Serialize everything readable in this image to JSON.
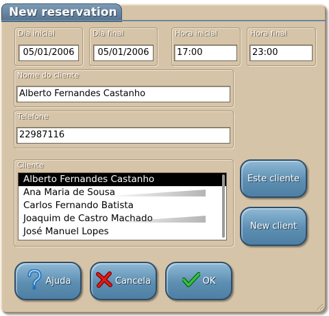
{
  "window": {
    "title": "New reservation"
  },
  "fields": {
    "start_day": {
      "label": "Dia inicial",
      "value": "05/01/2006"
    },
    "end_day": {
      "label": "Dia final",
      "value": "05/01/2006"
    },
    "start_time": {
      "label": "Hora inicial",
      "value": "17:00"
    },
    "end_time": {
      "label": "Hora final",
      "value": "23:00"
    },
    "client_name": {
      "label": "Nome do cliente",
      "value": "Alberto Fernandes Castanho"
    },
    "phone": {
      "label": "Telefone",
      "value": "22987116"
    }
  },
  "client_list": {
    "label": "Cliente",
    "items": [
      "Alberto Fernandes Castanho",
      "Ana Maria de Sousa",
      "Carlos Fernando Batista",
      "Joaquim de Castro Machado",
      "José Manuel Lopes"
    ],
    "selected": "Alberto Fernandes Castanho"
  },
  "buttons": {
    "this_client": "Este cliente",
    "new_client": "New client",
    "help": "Ajuda",
    "cancel": "Cancela",
    "ok": "OK"
  },
  "icons": {
    "help": "question-mark-icon",
    "cancel": "red-x-icon",
    "ok": "green-check-icon"
  },
  "colors": {
    "window_bg": "#d6c4a8",
    "button": "#5d8fb2",
    "title_tab": "#6a86a0"
  }
}
